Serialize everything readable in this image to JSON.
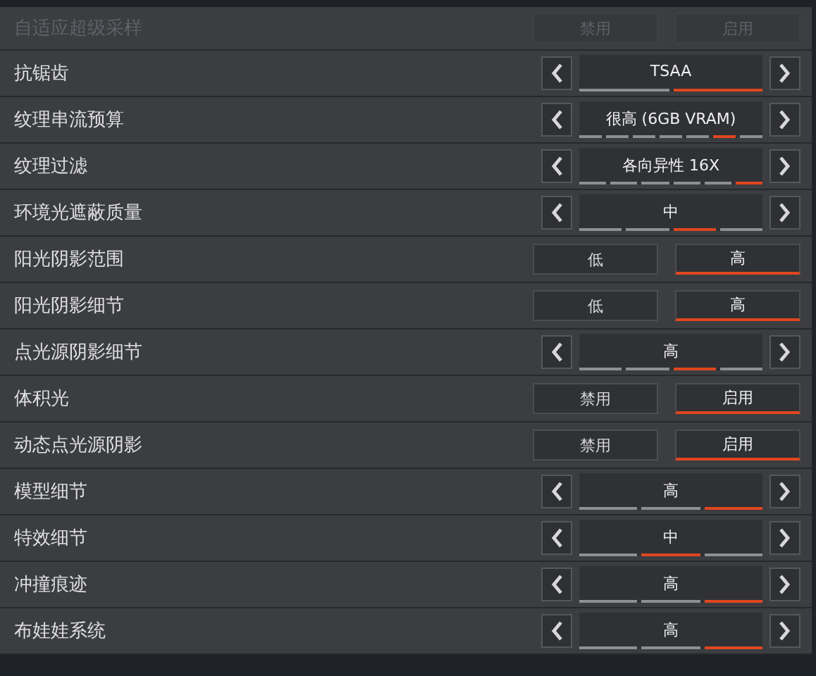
{
  "settings": [
    {
      "label": "自适应超级采样",
      "kind": "toggle",
      "disabled": true,
      "options": [
        {
          "label": "禁用",
          "selected": false
        },
        {
          "label": "启用",
          "selected": false
        }
      ]
    },
    {
      "label": "抗锯齿",
      "kind": "stepper",
      "disabled": false,
      "value": "TSAA",
      "segments": [
        {
          "selected": false
        },
        {
          "selected": true
        }
      ]
    },
    {
      "label": "纹理串流预算",
      "kind": "stepper",
      "disabled": false,
      "value": "很高 (6GB VRAM)",
      "segments": [
        {
          "selected": false
        },
        {
          "selected": false
        },
        {
          "selected": false
        },
        {
          "selected": false
        },
        {
          "selected": false
        },
        {
          "selected": true
        },
        {
          "selected": false
        }
      ]
    },
    {
      "label": "纹理过滤",
      "kind": "stepper",
      "disabled": false,
      "value": "各向异性 16X",
      "segments": [
        {
          "selected": false
        },
        {
          "selected": false
        },
        {
          "selected": false
        },
        {
          "selected": false
        },
        {
          "selected": false
        },
        {
          "selected": true
        }
      ]
    },
    {
      "label": "环境光遮蔽质量",
      "kind": "stepper",
      "disabled": false,
      "value": "中",
      "segments": [
        {
          "selected": false
        },
        {
          "selected": false
        },
        {
          "selected": true
        },
        {
          "selected": false
        }
      ]
    },
    {
      "label": "阳光阴影范围",
      "kind": "toggle",
      "disabled": false,
      "options": [
        {
          "label": "低",
          "selected": false
        },
        {
          "label": "高",
          "selected": true
        }
      ]
    },
    {
      "label": "阳光阴影细节",
      "kind": "toggle",
      "disabled": false,
      "options": [
        {
          "label": "低",
          "selected": false
        },
        {
          "label": "高",
          "selected": true
        }
      ]
    },
    {
      "label": "点光源阴影细节",
      "kind": "stepper",
      "disabled": false,
      "value": "高",
      "segments": [
        {
          "selected": false
        },
        {
          "selected": false
        },
        {
          "selected": true
        },
        {
          "selected": false
        }
      ]
    },
    {
      "label": "体积光",
      "kind": "toggle",
      "disabled": false,
      "options": [
        {
          "label": "禁用",
          "selected": false
        },
        {
          "label": "启用",
          "selected": true
        }
      ]
    },
    {
      "label": "动态点光源阴影",
      "kind": "toggle",
      "disabled": false,
      "options": [
        {
          "label": "禁用",
          "selected": false
        },
        {
          "label": "启用",
          "selected": true
        }
      ]
    },
    {
      "label": "模型细节",
      "kind": "stepper",
      "disabled": false,
      "value": "高",
      "segments": [
        {
          "selected": false
        },
        {
          "selected": false
        },
        {
          "selected": true
        }
      ]
    },
    {
      "label": "特效细节",
      "kind": "stepper",
      "disabled": false,
      "value": "中",
      "segments": [
        {
          "selected": false
        },
        {
          "selected": true
        },
        {
          "selected": false
        }
      ]
    },
    {
      "label": "冲撞痕迹",
      "kind": "stepper",
      "disabled": false,
      "value": "高",
      "segments": [
        {
          "selected": false
        },
        {
          "selected": false
        },
        {
          "selected": true
        }
      ]
    },
    {
      "label": "布娃娃系统",
      "kind": "stepper",
      "disabled": false,
      "value": "高",
      "segments": [
        {
          "selected": false
        },
        {
          "selected": false
        },
        {
          "selected": true
        }
      ]
    }
  ]
}
